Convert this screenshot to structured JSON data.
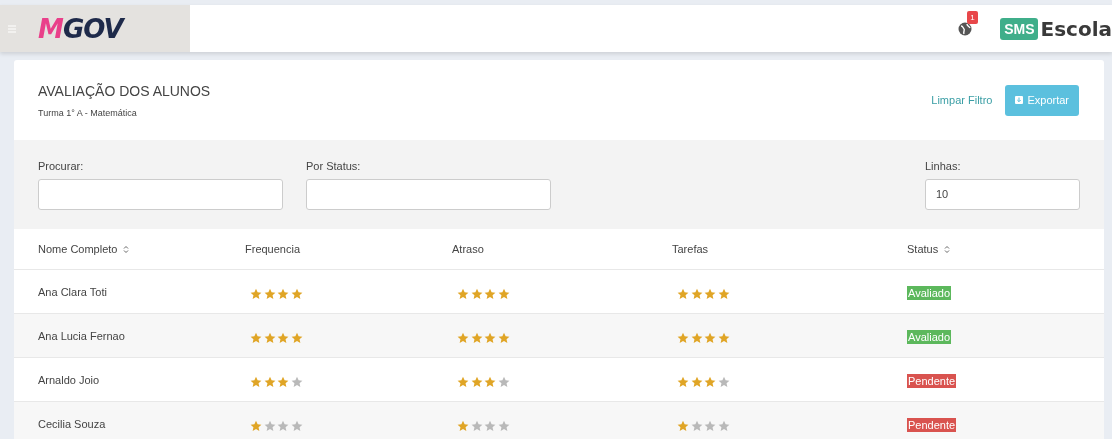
{
  "header": {
    "logo": "MGOV",
    "notifications": "1",
    "brand_badge": "SMS",
    "brand_name": "Escola"
  },
  "panel": {
    "title": "AVALIAÇÃO DOS ALUNOS",
    "subtitle": "Turma 1° A - Matemática",
    "clear_link": "Limpar Filtro",
    "export_button": "Exportar"
  },
  "filters": [
    {
      "label": "Procurar:"
    },
    {
      "label": "Por Status:"
    },
    {
      "label": "Linhas:",
      "value": "10"
    }
  ],
  "table": {
    "columns": [
      {
        "label": "Nome Completo",
        "sortable": true
      },
      {
        "label": "Frequencia",
        "sortable": false
      },
      {
        "label": "Atraso",
        "sortable": false
      },
      {
        "label": "Tarefas",
        "sortable": false
      },
      {
        "label": "Status",
        "sortable": true
      }
    ],
    "rows": [
      {
        "name": "Ana Clara Toti",
        "frequencia": {
          "stars": 4
        },
        "atraso": {
          "stars": 4
        },
        "tarefas": {
          "stars": 4
        },
        "status": {
          "label": "Avaliado",
          "color": "#5cb85c"
        }
      },
      {
        "name": "Ana Lucia Fernao",
        "frequencia": {
          "stars": 4
        },
        "atraso": {
          "stars": 4
        },
        "tarefas": {
          "stars": 4
        },
        "status": {
          "label": "Avaliado",
          "color": "#5cb85c"
        }
      },
      {
        "name": "Arnaldo Joio",
        "frequencia": {
          "stars": 3
        },
        "atraso": {
          "stars": 3
        },
        "tarefas": {
          "stars": 3
        },
        "status": {
          "label": "Pendente",
          "color": "#d9534f"
        }
      },
      {
        "name": "Cecilia Souza",
        "frequencia": {
          "stars": 1
        },
        "atraso": {
          "stars": 1
        },
        "tarefas": {
          "stars": 1
        },
        "status": {
          "label": "Pendente",
          "color": "#d9534f"
        }
      }
    ]
  }
}
